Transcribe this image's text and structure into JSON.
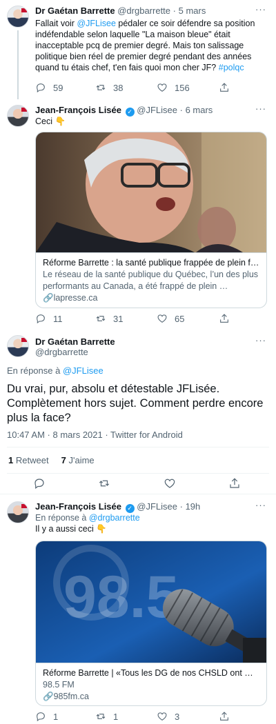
{
  "tweets": [
    {
      "name": "Dr Gaétan Barrette",
      "handle": "@drgbarrette",
      "sep": "·",
      "time": "5 mars",
      "text_pre": "Fallait voir ",
      "mention": "@JFLisee",
      "text_post": " pédaler ce soir défendre sa position indéfendable selon laquelle \"La maison bleue\" était inacceptable pcq de premier degré. Mais ton salissage politique bien réel de premier degré pendant des années quand tu étais chef, t'en fais quoi mon cher JF? ",
      "hashtag": "#polqc",
      "replies": "59",
      "retweets": "38",
      "likes": "156"
    },
    {
      "name": "Jean-François Lisée",
      "handle": "@JFLisee",
      "sep": "·",
      "time": "6 mars",
      "text": "Ceci 👇",
      "card": {
        "title": "Réforme Barrette : la santé publique frappée de plein fouet",
        "desc": "Le réseau de la santé publique du Québec, l’un des plus performants au Canada, a été frappé de plein …",
        "domain": "lapresse.ca"
      },
      "replies": "11",
      "retweets": "31",
      "likes": "65"
    }
  ],
  "focus": {
    "name": "Dr Gaétan Barrette",
    "handle": "@drgbarrette",
    "reply_prefix": "En réponse à ",
    "reply_to": "@JFLisee",
    "text": "Du vrai, pur, absolu et détestable JFLisée. Complètement hors sujet. Comment perdre encore plus la face?",
    "timestamp": "10:47 AM · 8 mars 2021 · Twitter for Android",
    "retweet_count": "1",
    "retweet_label": "Retweet",
    "like_count": "7",
    "like_label": "J'aime"
  },
  "reply": {
    "name": "Jean-François Lisée",
    "handle": "@JFLisee",
    "sep": "·",
    "time": "19h",
    "reply_prefix": "En réponse à ",
    "reply_to": "@drgbarrette",
    "text": "Il y a aussi ceci 👇",
    "card": {
      "title": "Réforme Barrette | «Tous les DG de nos CHSLD ont …",
      "desc": "98.5 FM",
      "domain": "985fm.ca",
      "image_text": "98.5"
    },
    "replies": "1",
    "retweets": "1",
    "likes": "3"
  },
  "more_glyph": "···",
  "colors": {
    "accent": "#1d9bf0",
    "muted": "#536471",
    "text": "#0f1419",
    "divider": "#eff3f4"
  }
}
